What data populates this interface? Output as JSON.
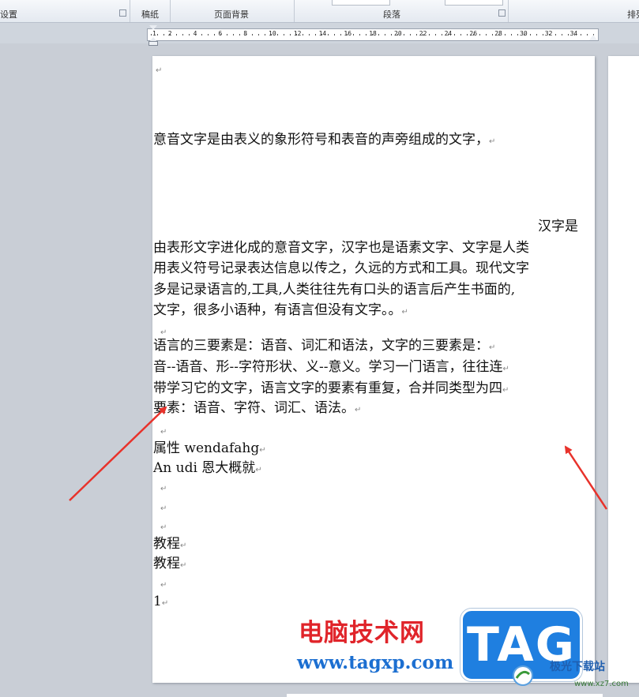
{
  "ribbon": {
    "groups": [
      {
        "label": "设置",
        "has_launcher": true
      },
      {
        "label": "稿纸",
        "has_launcher": false
      },
      {
        "label": "页面背景",
        "has_launcher": false
      },
      {
        "label": "段落",
        "has_launcher": true
      },
      {
        "label": "排列",
        "has_launcher": false
      }
    ]
  },
  "ruler": {
    "ticks": [
      "1",
      "2",
      "4",
      "6",
      "8",
      "10",
      "12",
      "14",
      "16",
      "18",
      "20",
      "22",
      "24",
      "26",
      "28",
      "30",
      "32",
      "34"
    ]
  },
  "document": {
    "paragraph_mark": "↵",
    "lines": [
      {
        "text": "",
        "mark": true
      },
      {
        "text": "意音文字是由表义的象形符号和表音的声旁组成的文字，",
        "mark": true
      },
      {
        "text": "汉字是",
        "mark": false
      },
      {
        "text": "由表形文字进化成的意音文字，汉字也是语素文字、文字是人类",
        "mark": false
      },
      {
        "text": "用表义符号记录表达信息以传之，久远的方式和工具。现代文字",
        "mark": false
      },
      {
        "text": "多是记录语言的,工具,人类往往先有口头的语言后产生书面的,",
        "mark": false
      },
      {
        "text": "文字，很多小语种，有语言但没有文字。。",
        "mark": true
      },
      {
        "text": "",
        "mark": true
      },
      {
        "text": "语言的三要素是：语音、词汇和语法，文字的三要素是：",
        "mark": true
      },
      {
        "text": "音--语音、形--字符形状、义--意义。学习一门语言，往往连",
        "mark": true
      },
      {
        "text": "带学习它的文字，语言文字的要素有重复，合并同类型为四",
        "mark": true
      },
      {
        "text": "要素：语音、字符、词汇、语法。",
        "mark": true
      },
      {
        "text": "",
        "mark": true
      },
      {
        "text": "属性  wendafahg",
        "mark": true
      },
      {
        "text": "An udi  恩大概就",
        "mark": true
      },
      {
        "text": "",
        "mark": true
      },
      {
        "text": "",
        "mark": true
      },
      {
        "text": "",
        "mark": true
      },
      {
        "text": "教程",
        "mark": true
      },
      {
        "text": "教程",
        "mark": true
      },
      {
        "text": "",
        "mark": true
      },
      {
        "text": "1",
        "mark": true
      }
    ]
  },
  "watermark": {
    "site_cn": "电脑技术网",
    "url": "www.tagxp.com",
    "tag": "TAG",
    "site_right": "极光下载站",
    "site_right_url": "www.xz7.com"
  },
  "colors": {
    "arrow": "#e8322b",
    "watermark_red": "#e0242a",
    "watermark_blue": "#1f7fe0"
  }
}
